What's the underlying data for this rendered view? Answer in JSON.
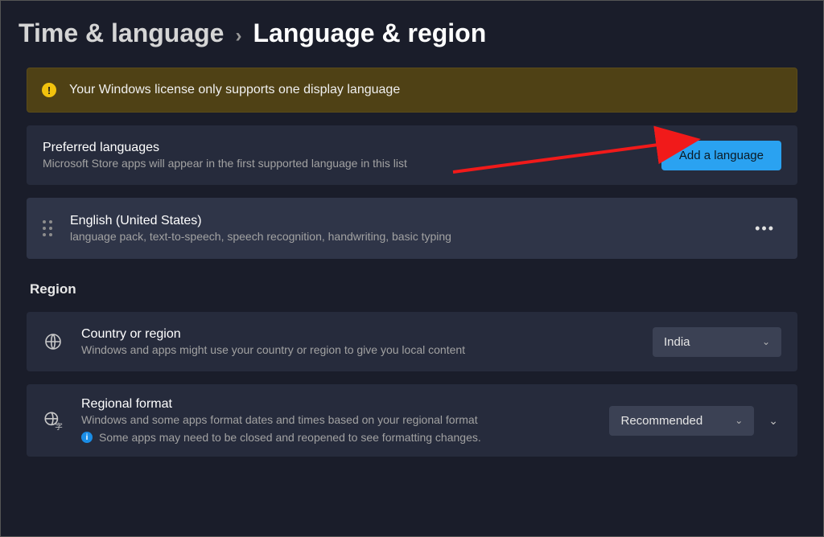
{
  "breadcrumb": {
    "parent": "Time & language",
    "sep": "›",
    "current": "Language & region"
  },
  "warning": {
    "text": "Your Windows license only supports one display language"
  },
  "preferred": {
    "title": "Preferred languages",
    "subtitle": "Microsoft Store apps will appear in the first supported language in this list",
    "add_button": "Add a language"
  },
  "language_item": {
    "name": "English (United States)",
    "features": "language pack, text-to-speech, speech recognition, handwriting, basic typing"
  },
  "region": {
    "heading": "Region",
    "country": {
      "title": "Country or region",
      "subtitle": "Windows and apps might use your country or region to give you local content",
      "value": "India"
    },
    "format": {
      "title": "Regional format",
      "subtitle": "Windows and some apps format dates and times based on your regional format",
      "notice": "Some apps may need to be closed and reopened to see formatting changes.",
      "value": "Recommended"
    }
  }
}
